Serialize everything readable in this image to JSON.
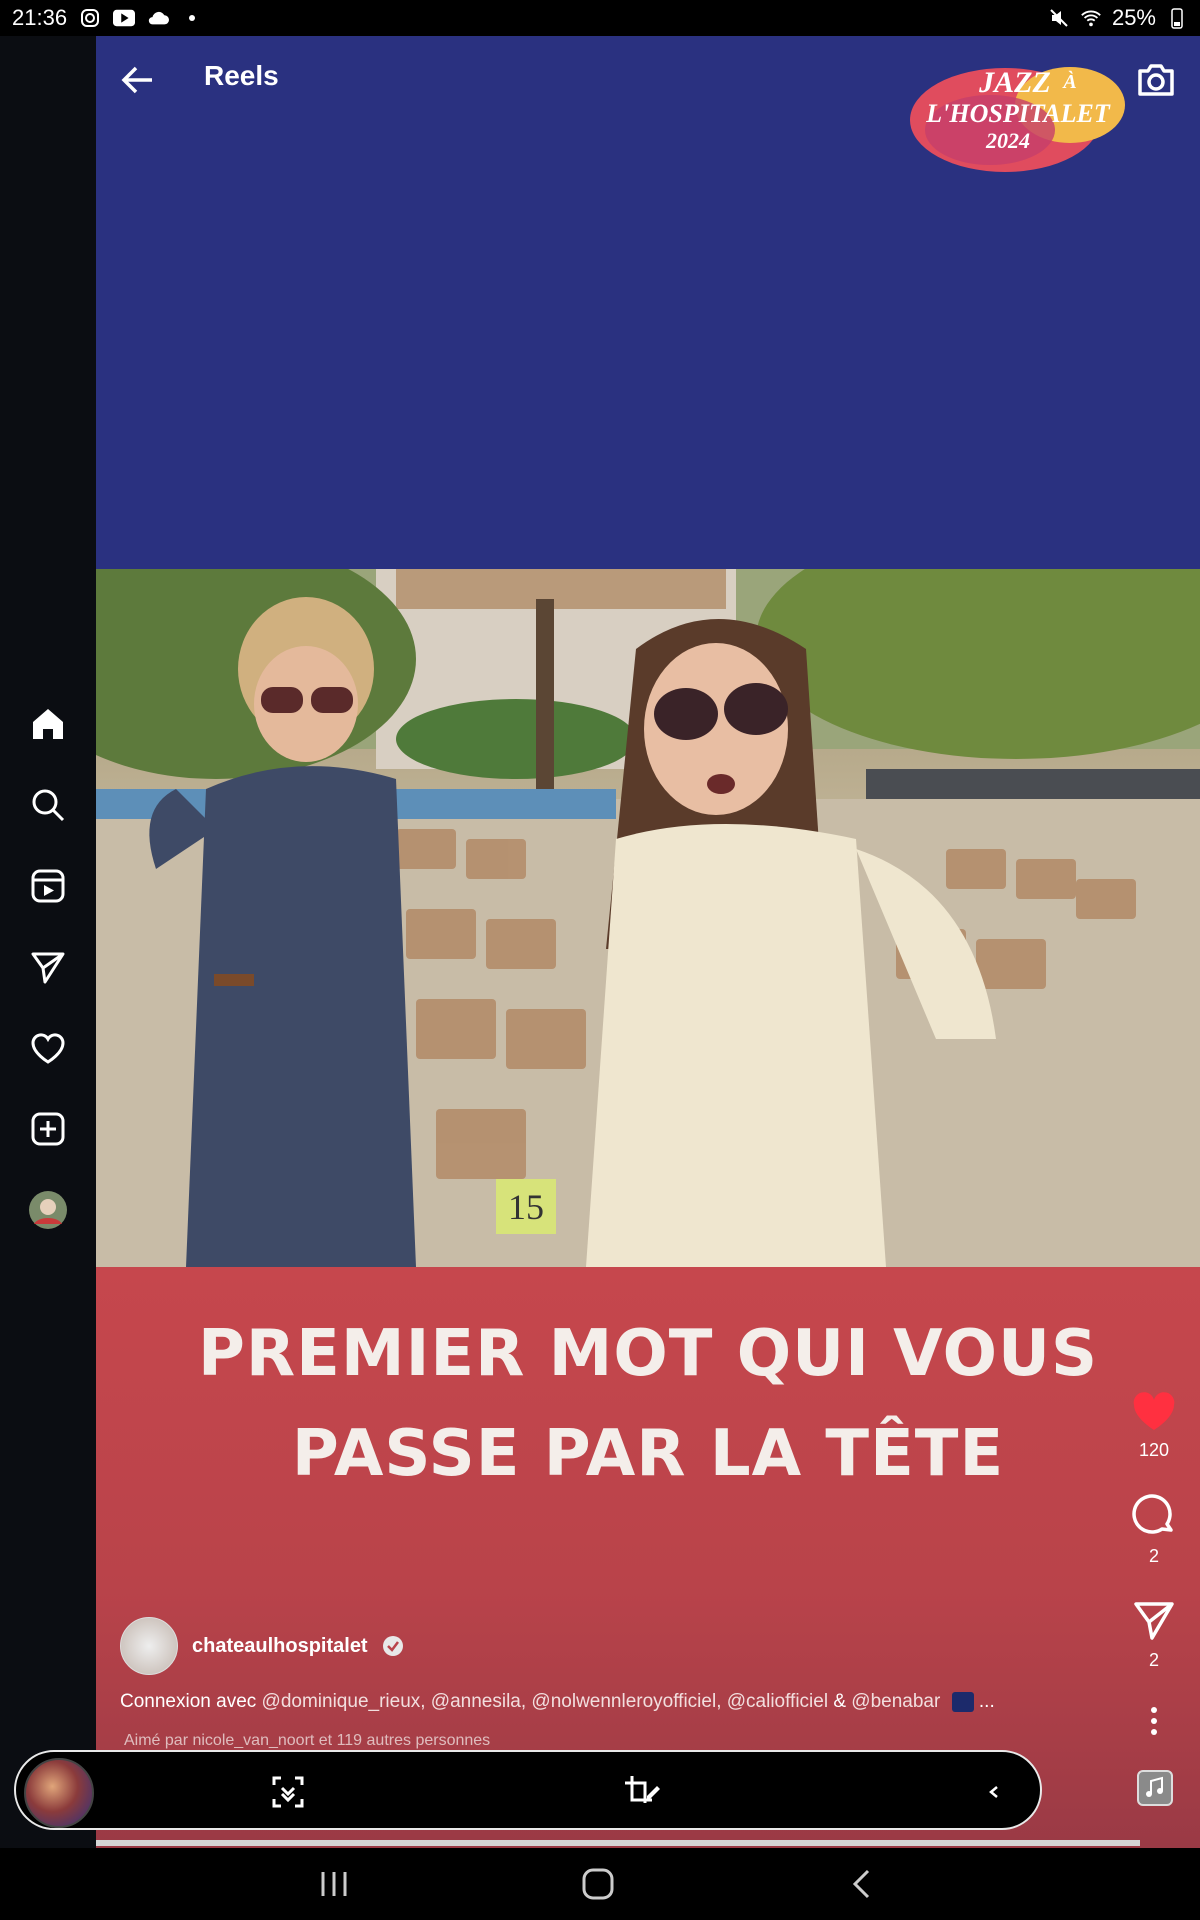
{
  "status_bar": {
    "time": "21:36",
    "battery": "25%",
    "icons_left": [
      "instagram-icon",
      "youtube-icon",
      "cloud-icon",
      "dot-icon"
    ],
    "icons_right": [
      "mute-icon",
      "wifi-icon",
      "battery-icon"
    ]
  },
  "header": {
    "title": "Reels"
  },
  "logo": {
    "line1": "JAZZ",
    "line2": "À",
    "line3": "L'HOSPITALET",
    "line4": "2024"
  },
  "video": {
    "seat_number": "15",
    "headline_line1": "PREMIER MOT QUI VOUS",
    "headline_line2": "PASSE PAR LA TÊTE"
  },
  "actions": {
    "likes": "120",
    "comments": "2",
    "shares": "2"
  },
  "author": {
    "username": "chateaulhospitalet"
  },
  "caption": {
    "prefix": "Connexion avec ",
    "mentions": "@dominique_rieux, @annesila, @nolwennleroyofficiel, @caliofficiel",
    "amp": " & ",
    "last": "@benabar",
    "ellipsis": " ..."
  },
  "liked_by": "Aimé par nicole_van_noort et 119 autres personnes",
  "colors": {
    "top_blue": "#2a3180",
    "bottom_red": "#c6474d",
    "like_red": "#ff3040"
  }
}
